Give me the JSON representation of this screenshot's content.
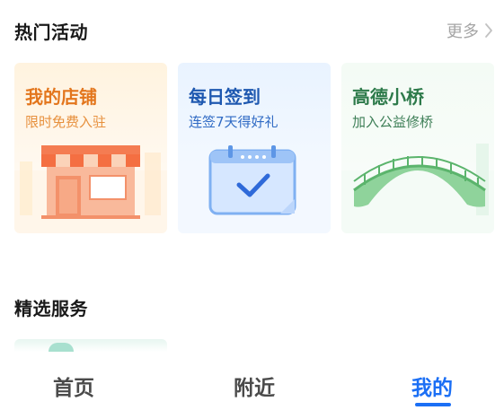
{
  "hot_activities": {
    "title": "热门活动",
    "more_label": "更多",
    "cards": [
      {
        "title": "我的店铺",
        "subtitle": "限时免费入驻",
        "icon": "storefront-icon"
      },
      {
        "title": "每日签到",
        "subtitle": "连签7天得好礼",
        "icon": "calendar-check-icon"
      },
      {
        "title": "高德小桥",
        "subtitle": "加入公益修桥",
        "icon": "bridge-icon"
      }
    ]
  },
  "featured_services": {
    "title": "精选服务"
  },
  "tab_bar": {
    "tabs": [
      {
        "label": "首页",
        "active": false
      },
      {
        "label": "附近",
        "active": false
      },
      {
        "label": "我的",
        "active": true
      }
    ]
  },
  "colors": {
    "active_tab": "#1b6ff5",
    "store_accent": "#e3761d",
    "checkin_accent": "#1e58b0",
    "bridge_accent": "#2d7a4a"
  }
}
